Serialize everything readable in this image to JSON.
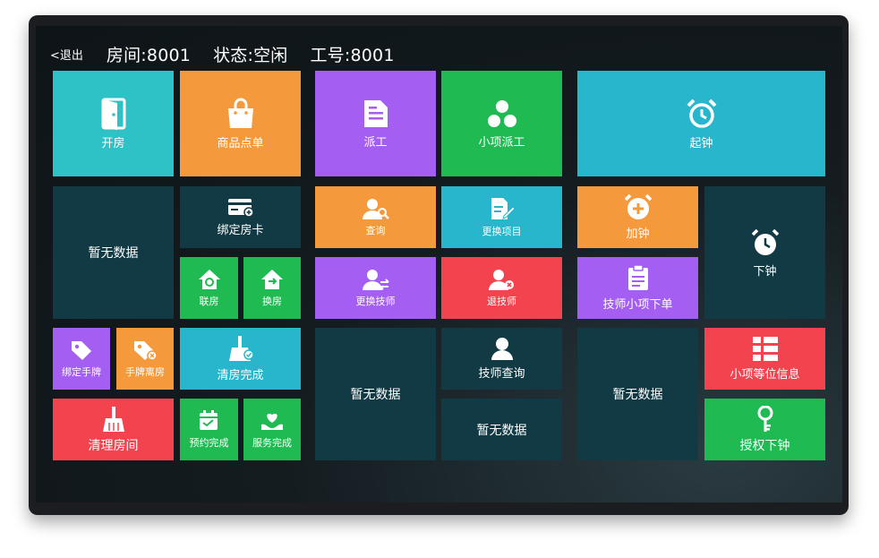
{
  "header": {
    "back_label": "<退出",
    "room": "房间:8001",
    "status": "状态:空闲",
    "employee_no": "工号:8001"
  },
  "colors": {
    "teal": "#2ec2c6",
    "orange": "#f59a3c",
    "purple": "#a45ef1",
    "green": "#1fba52",
    "red": "#f2434f",
    "dark_tile": "#123a44",
    "cyan": "#27b6cc"
  },
  "tiles": {
    "open_room": {
      "label": "开房",
      "icon": "door-icon"
    },
    "goods_order": {
      "label": "商品点单",
      "icon": "shopping-bag-icon"
    },
    "dispatch": {
      "label": "派工",
      "icon": "document-icon"
    },
    "item_dispatch": {
      "label": "小项派工",
      "icon": "cluster-icon"
    },
    "start_clock": {
      "label": "起钟",
      "icon": "alarm-clock-icon"
    },
    "empty_1": {
      "label": "暂无数据"
    },
    "bind_card": {
      "label": "绑定房卡",
      "icon": "card-icon"
    },
    "query": {
      "label": "查询",
      "icon": "user-search-icon"
    },
    "change_item": {
      "label": "更换项目",
      "icon": "edit-document-icon"
    },
    "add_clock": {
      "label": "加钟",
      "icon": "alarm-plus-icon"
    },
    "end_clock": {
      "label": "下钟",
      "icon": "clock-icon"
    },
    "link_room": {
      "label": "联房",
      "icon": "house-link-icon"
    },
    "swap_room": {
      "label": "换房",
      "icon": "house-swap-icon"
    },
    "change_tech": {
      "label": "更换技师",
      "icon": "user-swap-icon"
    },
    "return_tech": {
      "label": "退技师",
      "icon": "user-remove-icon"
    },
    "tech_item_order": {
      "label": "技师小项下单",
      "icon": "clipboard-icon"
    },
    "bind_tag": {
      "label": "绑定手牌",
      "icon": "tag-icon"
    },
    "tag_leave": {
      "label": "手牌离房",
      "icon": "tag-remove-icon"
    },
    "cleaning_done": {
      "label": "清房完成",
      "icon": "broom-check-icon"
    },
    "empty_2": {
      "label": "暂无数据"
    },
    "tech_query": {
      "label": "技师查询",
      "icon": "user-icon"
    },
    "empty_3": {
      "label": "暂无数据"
    },
    "item_wait_info": {
      "label": "小项等位信息",
      "icon": "list-grid-icon"
    },
    "clean_room": {
      "label": "清理房间",
      "icon": "broom-icon"
    },
    "booking_done": {
      "label": "预约完成",
      "icon": "calendar-icon"
    },
    "service_done": {
      "label": "服务完成",
      "icon": "heart-hand-icon"
    },
    "empty_4": {
      "label": "暂无数据"
    },
    "auth_end_clock": {
      "label": "授权下钟",
      "icon": "key-icon"
    }
  }
}
